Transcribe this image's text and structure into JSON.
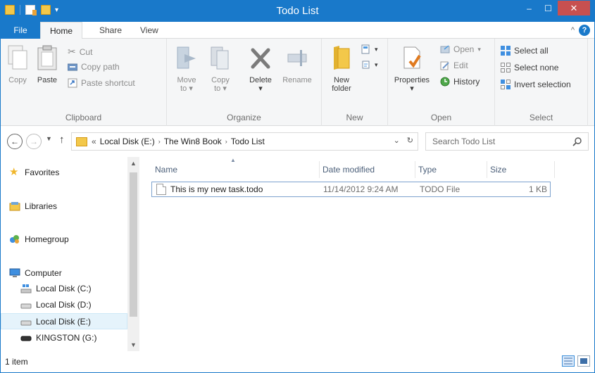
{
  "window": {
    "title": "Todo List"
  },
  "qat": {
    "icons": [
      "folder-icon",
      "properties-icon",
      "new-folder-icon",
      "dropdown-icon"
    ]
  },
  "window_controls": {
    "minimize": "–",
    "maximize": "☐",
    "close": "✕"
  },
  "ribbon_tabs": [
    {
      "label": "File",
      "active": false
    },
    {
      "label": "Home",
      "active": true
    },
    {
      "label": "Share",
      "active": false
    },
    {
      "label": "View",
      "active": false
    }
  ],
  "help": {
    "collapse": "^",
    "help": "?"
  },
  "ribbon": {
    "clipboard": {
      "label": "Clipboard",
      "copy": "Copy",
      "paste": "Paste",
      "cut": "Cut",
      "copy_path": "Copy path",
      "paste_shortcut": "Paste shortcut"
    },
    "organize": {
      "label": "Organize",
      "move_to": "Move",
      "move_to_2": "to",
      "copy_to": "Copy",
      "copy_to_2": "to",
      "delete": "Delete",
      "rename": "Rename"
    },
    "new": {
      "label": "New",
      "new_folder": "New",
      "new_folder_2": "folder"
    },
    "open": {
      "label": "Open",
      "properties": "Properties",
      "open": "Open",
      "edit": "Edit",
      "history": "History"
    },
    "select": {
      "label": "Select",
      "select_all": "Select all",
      "select_none": "Select none",
      "invert_selection": "Invert selection"
    }
  },
  "address": {
    "overflow": "«",
    "crumbs": [
      "Local Disk (E:)",
      "The Win8 Book",
      "Todo List"
    ],
    "separator": "›"
  },
  "search": {
    "placeholder": "Search Todo List"
  },
  "nav_pane": {
    "favorites": "Favorites",
    "libraries": "Libraries",
    "homegroup": "Homegroup",
    "computer": "Computer",
    "drives": [
      {
        "label": "Local Disk (C:)",
        "selected": false
      },
      {
        "label": "Local Disk (D:)",
        "selected": false
      },
      {
        "label": "Local Disk (E:)",
        "selected": true
      },
      {
        "label": "KINGSTON (G:)",
        "selected": false
      }
    ]
  },
  "file_list": {
    "columns": [
      "Name",
      "Date modified",
      "Type",
      "Size"
    ],
    "rows": [
      {
        "name": "This is my new task.todo",
        "date_modified": "11/14/2012 9:24 AM",
        "type": "TODO File",
        "size": "1 KB"
      }
    ]
  },
  "status": {
    "item_count": "1 item"
  },
  "colors": {
    "accent": "#1979ca",
    "close_button": "#c75050",
    "ribbon_bg": "#f5f6f7",
    "selection_border": "#7da2ce"
  }
}
